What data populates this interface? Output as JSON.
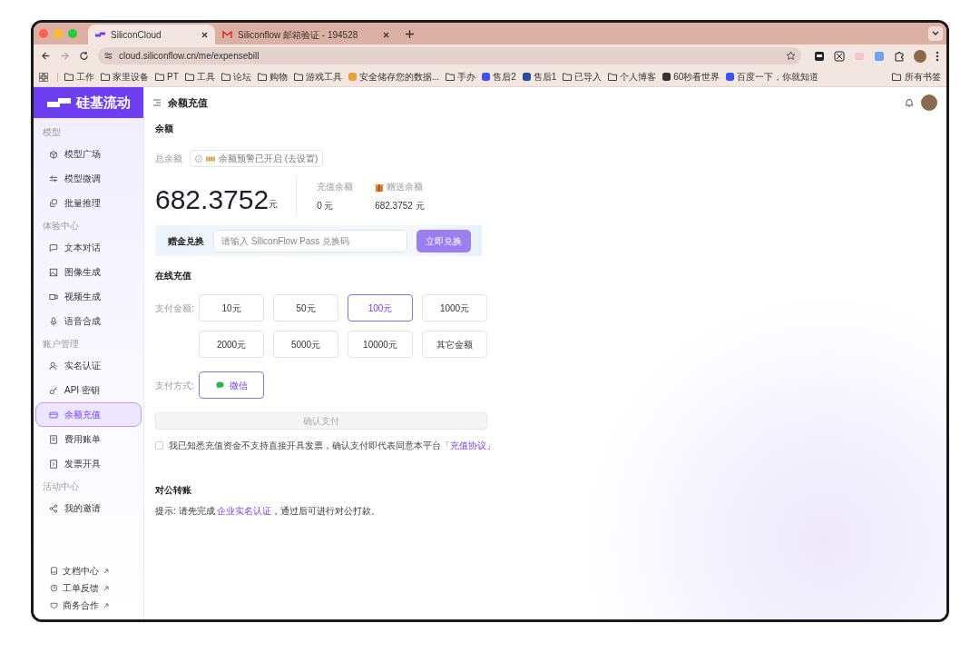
{
  "browser": {
    "tabs": [
      {
        "title": "SiliconCloud",
        "selected": true,
        "kind": "brand"
      },
      {
        "title": "Siliconflow 邮箱验证 - 194528",
        "selected": false,
        "kind": "mail"
      }
    ],
    "address": "cloud.siliconflow.cn/me/expensebill",
    "bookmarks": [
      {
        "label": "工作",
        "kind": "folder"
      },
      {
        "label": "家里设备",
        "kind": "folder"
      },
      {
        "label": "PT",
        "kind": "folder"
      },
      {
        "label": "工具",
        "kind": "folder"
      },
      {
        "label": "论坛",
        "kind": "folder"
      },
      {
        "label": "购物",
        "kind": "folder"
      },
      {
        "label": "游戏工具",
        "kind": "folder"
      },
      {
        "label": "安全储存您的数据...",
        "kind": "site"
      },
      {
        "label": "手办",
        "kind": "folder"
      },
      {
        "label": "售后2",
        "kind": "site"
      },
      {
        "label": "售后1",
        "kind": "site"
      },
      {
        "label": "已导入",
        "kind": "folder"
      },
      {
        "label": "个人博客",
        "kind": "folder"
      },
      {
        "label": "60秒看世界",
        "kind": "site"
      },
      {
        "label": "百度一下，你就知道",
        "kind": "site"
      }
    ],
    "all_bookmarks": "所有书签"
  },
  "app": {
    "logo": "硅基流动",
    "page_title": "余额充值",
    "sidebar": [
      {
        "heading": "模型",
        "items": [
          {
            "label": "模型广场",
            "selected": false
          },
          {
            "label": "模型微调",
            "selected": false
          },
          {
            "label": "批量推理",
            "selected": false
          }
        ]
      },
      {
        "heading": "体验中心",
        "items": [
          {
            "label": "文本对话",
            "selected": false
          },
          {
            "label": "图像生成",
            "selected": false
          },
          {
            "label": "视频生成",
            "selected": false
          },
          {
            "label": "语音合成",
            "selected": false
          }
        ]
      },
      {
        "heading": "账户管理",
        "items": [
          {
            "label": "实名认证",
            "selected": false
          },
          {
            "label": "API 密钥",
            "selected": false
          },
          {
            "label": "余额充值",
            "selected": true
          },
          {
            "label": "费用账单",
            "selected": false
          },
          {
            "label": "发票开具",
            "selected": false
          }
        ]
      },
      {
        "heading": "活动中心",
        "items": [
          {
            "label": "我的邀请",
            "selected": false
          }
        ]
      }
    ],
    "footer_links": [
      "文档中心",
      "工单反馈",
      "商务合作"
    ],
    "balance": {
      "heading": "余额",
      "total_label": "总余额",
      "alert_badge": "余额预警已开启 (去设置)",
      "total": "682.3752",
      "unit": "元",
      "recharge_label": "充值余额",
      "recharge_value": "0 元",
      "gift_label": "赠送余额",
      "gift_value": "682.3752 元"
    },
    "redeem": {
      "label": "赠金兑换",
      "placeholder": "请输入 SiliconFlow Pass 兑换码",
      "button": "立即兑换"
    },
    "online": {
      "heading": "在线充值",
      "amount_label": "支付金额:",
      "amounts": [
        {
          "label": "10元",
          "selected": false
        },
        {
          "label": "50元",
          "selected": false
        },
        {
          "label": "100元",
          "selected": true
        },
        {
          "label": "1000元",
          "selected": false
        },
        {
          "label": "2000元",
          "selected": false
        },
        {
          "label": "5000元",
          "selected": false
        },
        {
          "label": "10000元",
          "selected": false
        },
        {
          "label": "其它金额",
          "selected": false
        }
      ],
      "method_label": "支付方式:",
      "methods": [
        {
          "label": "微信",
          "selected": true
        }
      ],
      "confirm": {
        "label": "确认支付",
        "disabled": true
      },
      "agreement": {
        "checked": false,
        "text": "我已知悉充值资金不支持直接开具发票，确认支付即代表同意本平台",
        "link": "「充值协议」"
      }
    },
    "transfer": {
      "heading": "对公转账",
      "prefix": "提示: 请先完成",
      "link": "企业实名认证",
      "suffix": "，通过后可进行对公打款。"
    }
  }
}
